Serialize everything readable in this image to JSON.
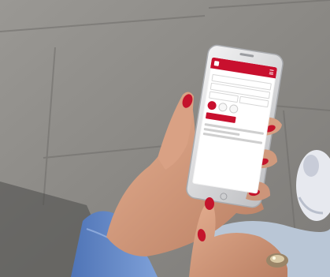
{
  "photo": {
    "subject": "hand-holding-phone",
    "colors": {
      "pavement": "#8e8c88",
      "skin": "#d49a7c",
      "nail_polish": "#c4142c",
      "sleeve": "#5d86c8",
      "phone_body": "#d9dadc",
      "app_accent": "#c8102e"
    }
  },
  "app": {
    "header_title": "",
    "heading": "",
    "fields": [
      {
        "placeholder": ""
      },
      {
        "placeholder": ""
      }
    ],
    "date_fields": [
      {
        "value": ""
      },
      {
        "value": ""
      }
    ],
    "subheading": "",
    "cta_label": ""
  }
}
